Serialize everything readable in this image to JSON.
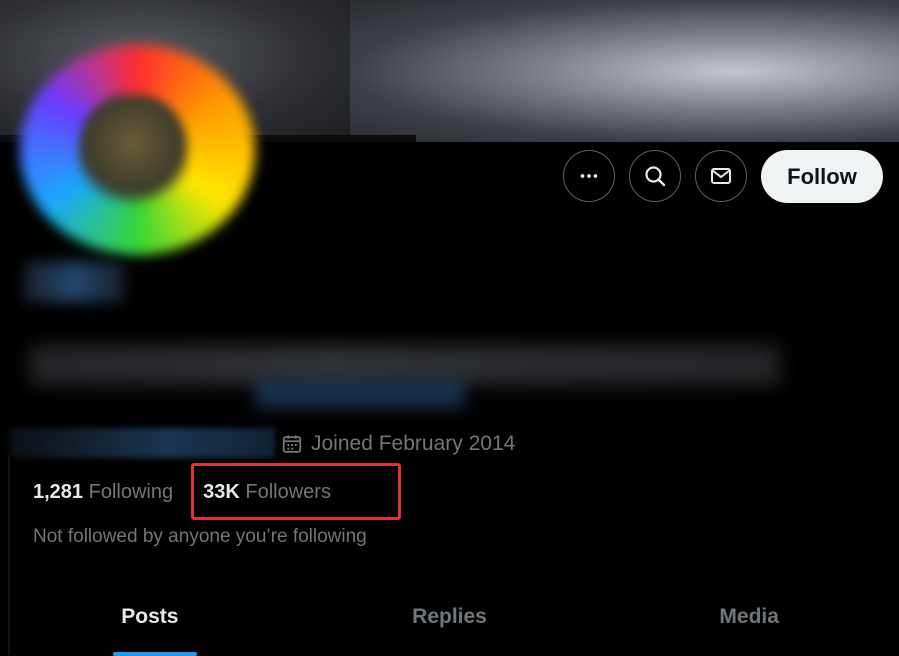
{
  "header": {
    "more_icon": "more-horizontal-icon",
    "search_icon": "search-icon",
    "message_icon": "envelope-icon",
    "follow_label": "Follow"
  },
  "profile": {
    "joined_text": "Joined February 2014",
    "calendar_icon": "calendar-icon",
    "following_count": "1,281",
    "following_label": "Following",
    "followers_count": "33K",
    "followers_label": "Followers",
    "not_followed_text": "Not followed by anyone you’re following"
  },
  "tabs": [
    {
      "label": "Posts",
      "active": true
    },
    {
      "label": "Replies",
      "active": false
    },
    {
      "label": "Media",
      "active": false
    }
  ],
  "colors": {
    "accent": "#1d9bf0",
    "highlight_box": "#e0303a",
    "muted_text": "#71767b"
  }
}
